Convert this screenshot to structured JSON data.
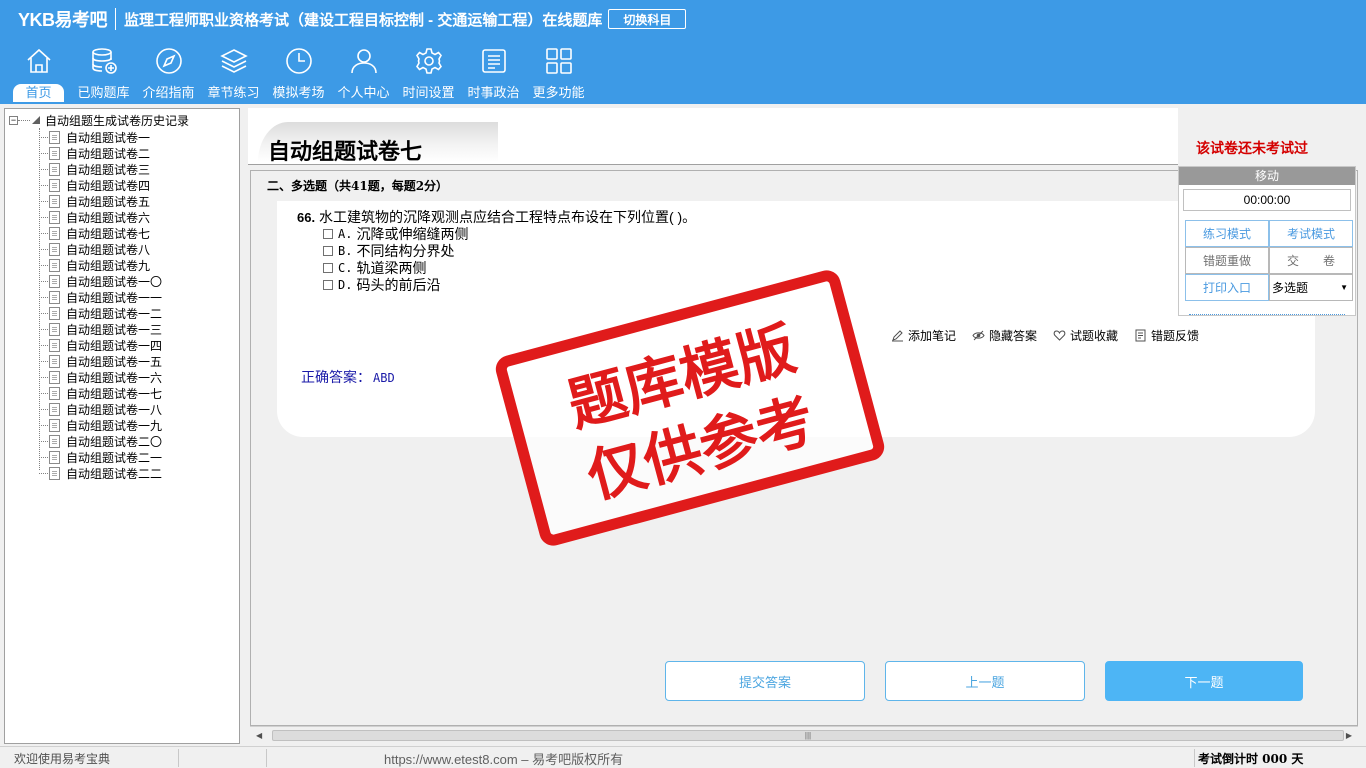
{
  "header": {
    "logo": "YKB易考吧",
    "title": "监理工程师职业资格考试（建设工程目标控制 - 交通运输工程）在线题库",
    "switch_subject": "切换科目"
  },
  "nav": [
    {
      "label": "首页",
      "icon": "home-icon"
    },
    {
      "label": "已购题库",
      "icon": "database-icon"
    },
    {
      "label": "介绍指南",
      "icon": "compass-icon"
    },
    {
      "label": "章节练习",
      "icon": "layers-icon"
    },
    {
      "label": "模拟考场",
      "icon": "clock-icon"
    },
    {
      "label": "个人中心",
      "icon": "user-icon"
    },
    {
      "label": "时间设置",
      "icon": "gear-icon"
    },
    {
      "label": "时事政治",
      "icon": "news-icon"
    },
    {
      "label": "更多功能",
      "icon": "grid-icon"
    }
  ],
  "tree": {
    "root_label": "自动组题生成试卷历史记录",
    "items": [
      "自动组题试卷一",
      "自动组题试卷二",
      "自动组题试卷三",
      "自动组题试卷四",
      "自动组题试卷五",
      "自动组题试卷六",
      "自动组题试卷七",
      "自动组题试卷八",
      "自动组题试卷九",
      "自动组题试卷一〇",
      "自动组题试卷一一",
      "自动组题试卷一二",
      "自动组题试卷一三",
      "自动组题试卷一四",
      "自动组题试卷一五",
      "自动组题试卷一六",
      "自动组题试卷一七",
      "自动组题试卷一八",
      "自动组题试卷一九",
      "自动组题试卷二〇",
      "自动组题试卷二一",
      "自动组题试卷二二"
    ]
  },
  "paper": {
    "title": "自动组题试卷七",
    "status": "该试卷还未考试过",
    "section_title": "二、多选题（共41题，每题2分）"
  },
  "question": {
    "number": "66.",
    "text": "水工建筑物的沉降观测点应结合工程特点布设在下列位置(  )。",
    "options": [
      {
        "letter": "A.",
        "text": "沉降或伸缩缝两侧"
      },
      {
        "letter": "B.",
        "text": "不同结构分界处"
      },
      {
        "letter": "C.",
        "text": "轨道梁两侧"
      },
      {
        "letter": "D.",
        "text": "码头的前后沿"
      }
    ],
    "answer_label": "正确答案：",
    "answer_value": "ABD"
  },
  "tools": {
    "add_note": "添加笔记",
    "hide_answer": "隐藏答案",
    "favorite": "试题收藏",
    "report_error": "错题反馈"
  },
  "float_panel": {
    "move": "移动",
    "timer": "00:00:00",
    "practice_mode": "练习模式",
    "exam_mode": "考试模式",
    "redo_wrong": "错题重做",
    "submit_paper": "交　　卷",
    "print": "打印入口",
    "question_type": "多选题"
  },
  "buttons": {
    "submit_answer": "提交答案",
    "prev": "上一题",
    "next": "下一题"
  },
  "watermark": {
    "line1": "题库模版",
    "line2": "仅供参考"
  },
  "status_bar": {
    "welcome": "欢迎使用易考宝典",
    "url": "https://www.etest8.com – 易考吧版权所有",
    "countdown": "考试倒计时 000 天"
  },
  "colors": {
    "header_bg": "#3d9ae6",
    "watermark_red": "#e01b1b",
    "status_red": "#d40000",
    "answer_blue": "#1a1aa8"
  }
}
